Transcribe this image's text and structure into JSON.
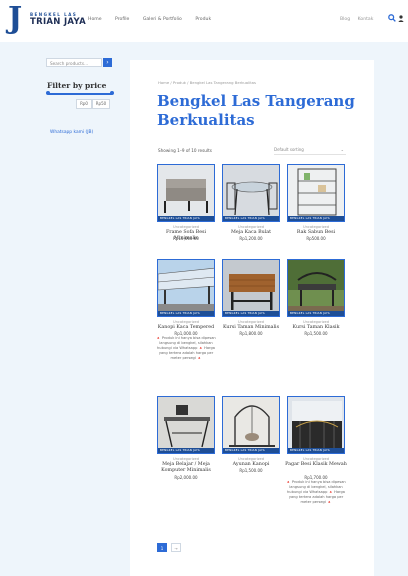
{
  "header": {
    "logo_top": "BENGKEL LAS",
    "logo_bottom": "TRIAN JAYA",
    "nav": [
      "Home",
      "Profile",
      "Galeri & Portfolio",
      "Produk"
    ],
    "right_links": [
      "Blog",
      "Kontak"
    ]
  },
  "sidebar": {
    "search_placeholder": "Search products…",
    "search_button": "›",
    "filter_title": "Filter by price",
    "price_min": "Rp0",
    "price_max": "Rp50",
    "whatsapp_link": "Whatsapp kami (JB)"
  },
  "main": {
    "breadcrumb": "Home / Produk / Bengkel Las Tangerang Berkualitas",
    "title": "Bengkel Las Tangerang Berkualitas",
    "result_count": "Showing 1–9 of 10 results",
    "sort_label": "Default sorting"
  },
  "banner_text": "BENGKEL LAS TRIAN JAYA",
  "products": [
    {
      "category": "Uncategorized",
      "name": "Frame Sofa Besi Minimalis",
      "price": "Rp10,000.00",
      "desc": ""
    },
    {
      "category": "Uncategorized",
      "name": "Meja Kaca Bulat",
      "price": "Rp1,200.00",
      "desc": ""
    },
    {
      "category": "Uncategorized",
      "name": "Rak Sabun Besi",
      "price": "Rp500.00",
      "desc": ""
    },
    {
      "category": "Uncategorized",
      "name": "Kanopi Kaca Tempered",
      "price": "Rp1,000.00",
      "desc": "🔺 Produk ini hanya bisa dipesan langsung di bengkel, silahkan hubungi via Whatsapp 🔺 Harga yang tertera adalah harga per meter persegi 🔺"
    },
    {
      "category": "Uncategorized",
      "name": "Kursi Taman Minimalis",
      "price": "Rp1,800.00",
      "desc": ""
    },
    {
      "category": "Uncategorized",
      "name": "Kursi Taman Klasik",
      "price": "Rp1,500.00",
      "desc": ""
    },
    {
      "category": "Uncategorized",
      "name": "Meja Belajar / Meja Komputer Minimalis",
      "price": "Rp2,000.00",
      "desc": ""
    },
    {
      "category": "Uncategorized",
      "name": "Ayunan Kanopi",
      "price": "Rp1,500.00",
      "desc": ""
    },
    {
      "category": "Uncategorized",
      "name": "Pagar Besi Klasik Mewah",
      "price": "Rp1,700.00",
      "desc": "🔺 Produk ini hanya bisa dipesan langsung di bengkel, silahkan hubungi via Whatsapp 🔺 Harga yang tertera adalah harga per meter persegi 🔺"
    }
  ],
  "pagination": {
    "current": "1",
    "next": "→"
  },
  "colors": {
    "accent": "#2d6bd6",
    "brand_dark": "#1e4e96",
    "background": "#eef5fb"
  }
}
